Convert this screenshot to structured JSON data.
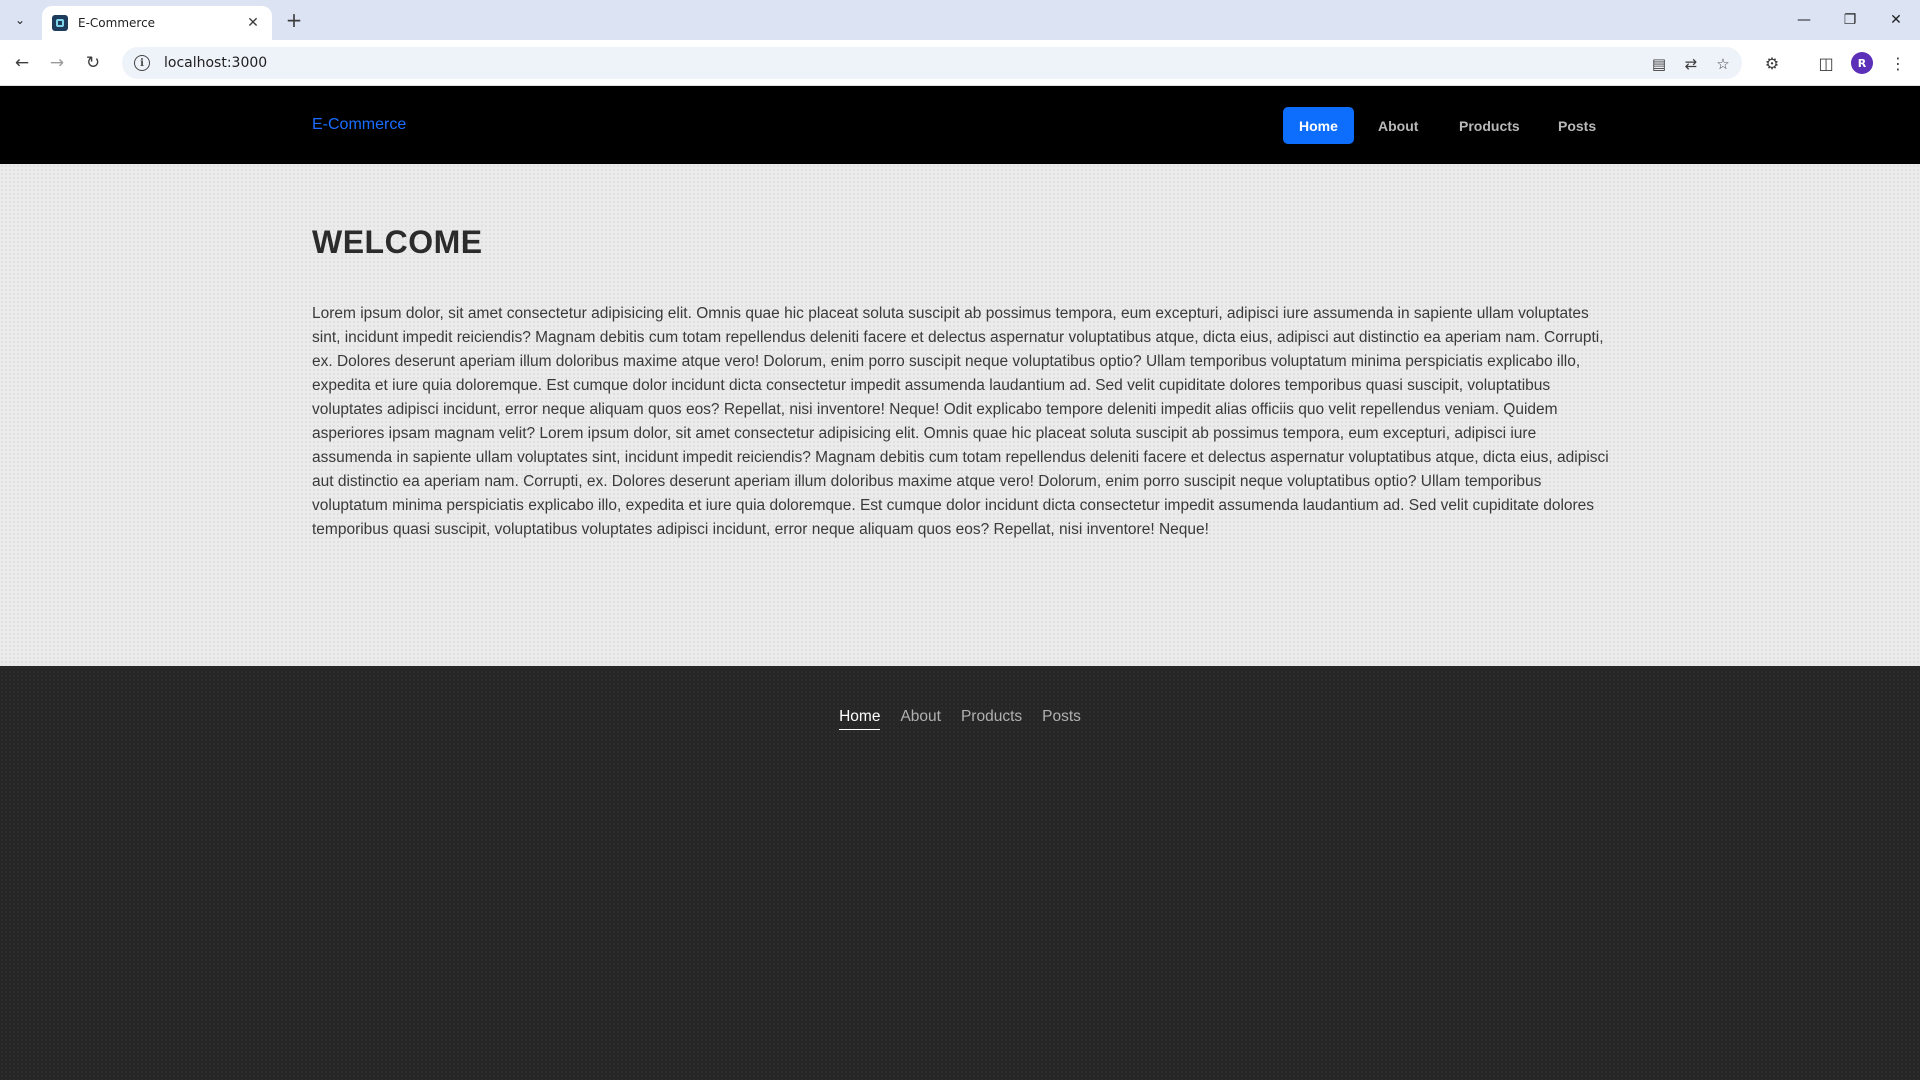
{
  "browser": {
    "tab_title": "E-Commerce",
    "url": "localhost:3000",
    "profile_initial": "R"
  },
  "site": {
    "brand": "E-Commerce",
    "nav": [
      {
        "label": "Home",
        "active": true
      },
      {
        "label": "About",
        "active": false
      },
      {
        "label": "Products",
        "active": false
      },
      {
        "label": "Posts",
        "active": false
      }
    ],
    "heading": "WELCOME",
    "body_text": "Lorem ipsum dolor, sit amet consectetur adipisicing elit. Omnis quae hic placeat soluta suscipit ab possimus tempora, eum excepturi, adipisci iure assumenda in sapiente ullam voluptates sint, incidunt impedit reiciendis? Magnam debitis cum totam repellendus deleniti facere et delectus aspernatur voluptatibus atque, dicta eius, adipisci aut distinctio ea aperiam nam. Corrupti, ex. Dolores deserunt aperiam illum doloribus maxime atque vero! Dolorum, enim porro suscipit neque voluptatibus optio? Ullam temporibus voluptatum minima perspiciatis explicabo illo, expedita et iure quia doloremque. Est cumque dolor incidunt dicta consectetur impedit assumenda laudantium ad. Sed velit cupiditate dolores temporibus quasi suscipit, voluptatibus voluptates adipisci incidunt, error neque aliquam quos eos? Repellat, nisi inventore! Neque! Odit explicabo tempore deleniti impedit alias officiis quo velit repellendus veniam. Quidem asperiores ipsam magnam velit? Lorem ipsum dolor, sit amet consectetur adipisicing elit. Omnis quae hic placeat soluta suscipit ab possimus tempora, eum excepturi, adipisci iure assumenda in sapiente ullam voluptates sint, incidunt impedit reiciendis? Magnam debitis cum totam repellendus deleniti facere et delectus aspernatur voluptatibus atque, dicta eius, adipisci aut distinctio ea aperiam nam. Corrupti, ex. Dolores deserunt aperiam illum doloribus maxime atque vero! Dolorum, enim porro suscipit neque voluptatibus optio? Ullam temporibus voluptatum minima perspiciatis explicabo illo, expedita et iure quia doloremque. Est cumque dolor incidunt dicta consectetur impedit assumenda laudantium ad. Sed velit cupiditate dolores temporibus quasi suscipit, voluptatibus voluptates adipisci incidunt, error neque aliquam quos eos? Repellat, nisi inventore! Neque!",
    "footer_nav": [
      {
        "label": "Home",
        "active": true
      },
      {
        "label": "About",
        "active": false
      },
      {
        "label": "Products",
        "active": false
      },
      {
        "label": "Posts",
        "active": false
      }
    ]
  },
  "colors": {
    "accent": "#0d6efd",
    "brand": "#1a6dff",
    "header_bg": "#000000",
    "footer_bg": "#262626"
  }
}
